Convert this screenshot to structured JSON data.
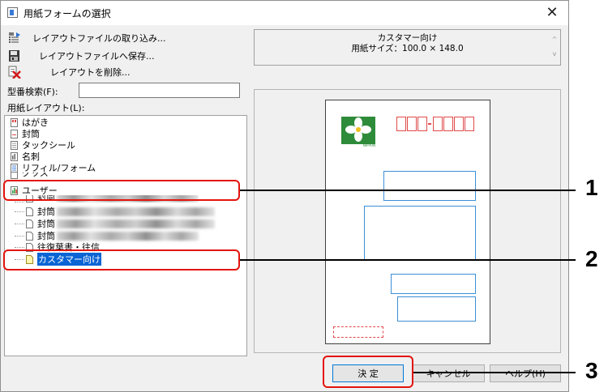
{
  "window": {
    "title": "用紙フォームの選択"
  },
  "toolbar": {
    "import_label": "レイアウトファイルの取り込み...",
    "save_label": "レイアウトファイルへ保存...",
    "delete_label": "レイアウトを削除..."
  },
  "info": {
    "name": "カスタマー向け",
    "size_line": "用紙サイズ：100.0 × 148.0"
  },
  "search": {
    "label": "型番検索(F):",
    "value": ""
  },
  "tree": {
    "label": "用紙レイアウト(L):",
    "items": [
      {
        "label": "はがき"
      },
      {
        "label": "封筒"
      },
      {
        "label": "タックシール"
      },
      {
        "label": "名刺"
      },
      {
        "label": "リフィル/フォーム"
      },
      {
        "label": "グッズ"
      },
      {
        "label": "ユーザー"
      },
      {
        "label": "封筒"
      },
      {
        "label": "封筒"
      },
      {
        "label": "封筒"
      },
      {
        "label": "封筒"
      },
      {
        "label": "往復葉書・往信"
      },
      {
        "label": "カスタマー向け"
      }
    ]
  },
  "preview": {
    "logo_text": "NIPPON"
  },
  "buttons": {
    "ok": "決 定",
    "cancel": "キャンセル",
    "help": "ヘルプ(H)"
  },
  "callouts": [
    "1",
    "2",
    "3"
  ],
  "colors": {
    "callout": "#e3140d",
    "selection": "#0a64d4",
    "zip": "#e04a4a",
    "address": "#3b8fd6"
  }
}
